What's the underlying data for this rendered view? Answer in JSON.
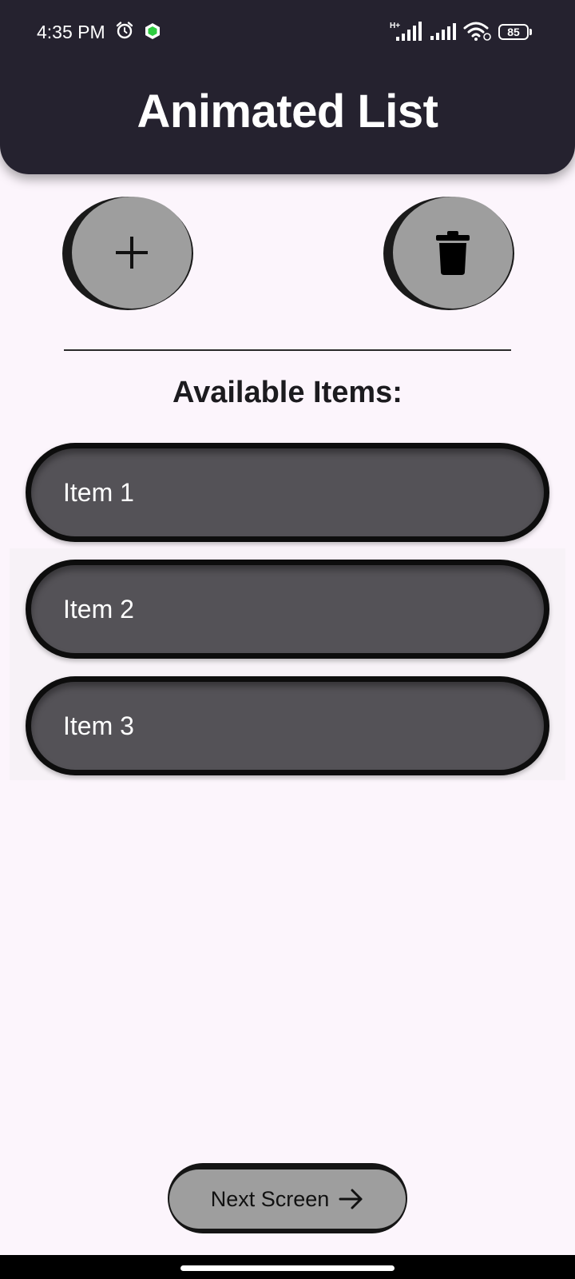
{
  "status_bar": {
    "time": "4:35 PM",
    "network_type": "H+",
    "battery": "85",
    "icons": [
      "alarm-icon",
      "shield-icon",
      "signal-icon",
      "signal-icon",
      "wifi-icon",
      "battery-icon"
    ]
  },
  "app_bar": {
    "title": "Animated List",
    "background": "#25222f"
  },
  "actions": {
    "add_icon": "plus-icon",
    "delete_icon": "trash-icon"
  },
  "section": {
    "title": "Available Items:"
  },
  "items": [
    {
      "label": "Item 1"
    },
    {
      "label": "Item 2"
    },
    {
      "label": "Item 3"
    }
  ],
  "footer": {
    "next_label": "Next Screen",
    "next_icon": "arrow-right-icon"
  }
}
